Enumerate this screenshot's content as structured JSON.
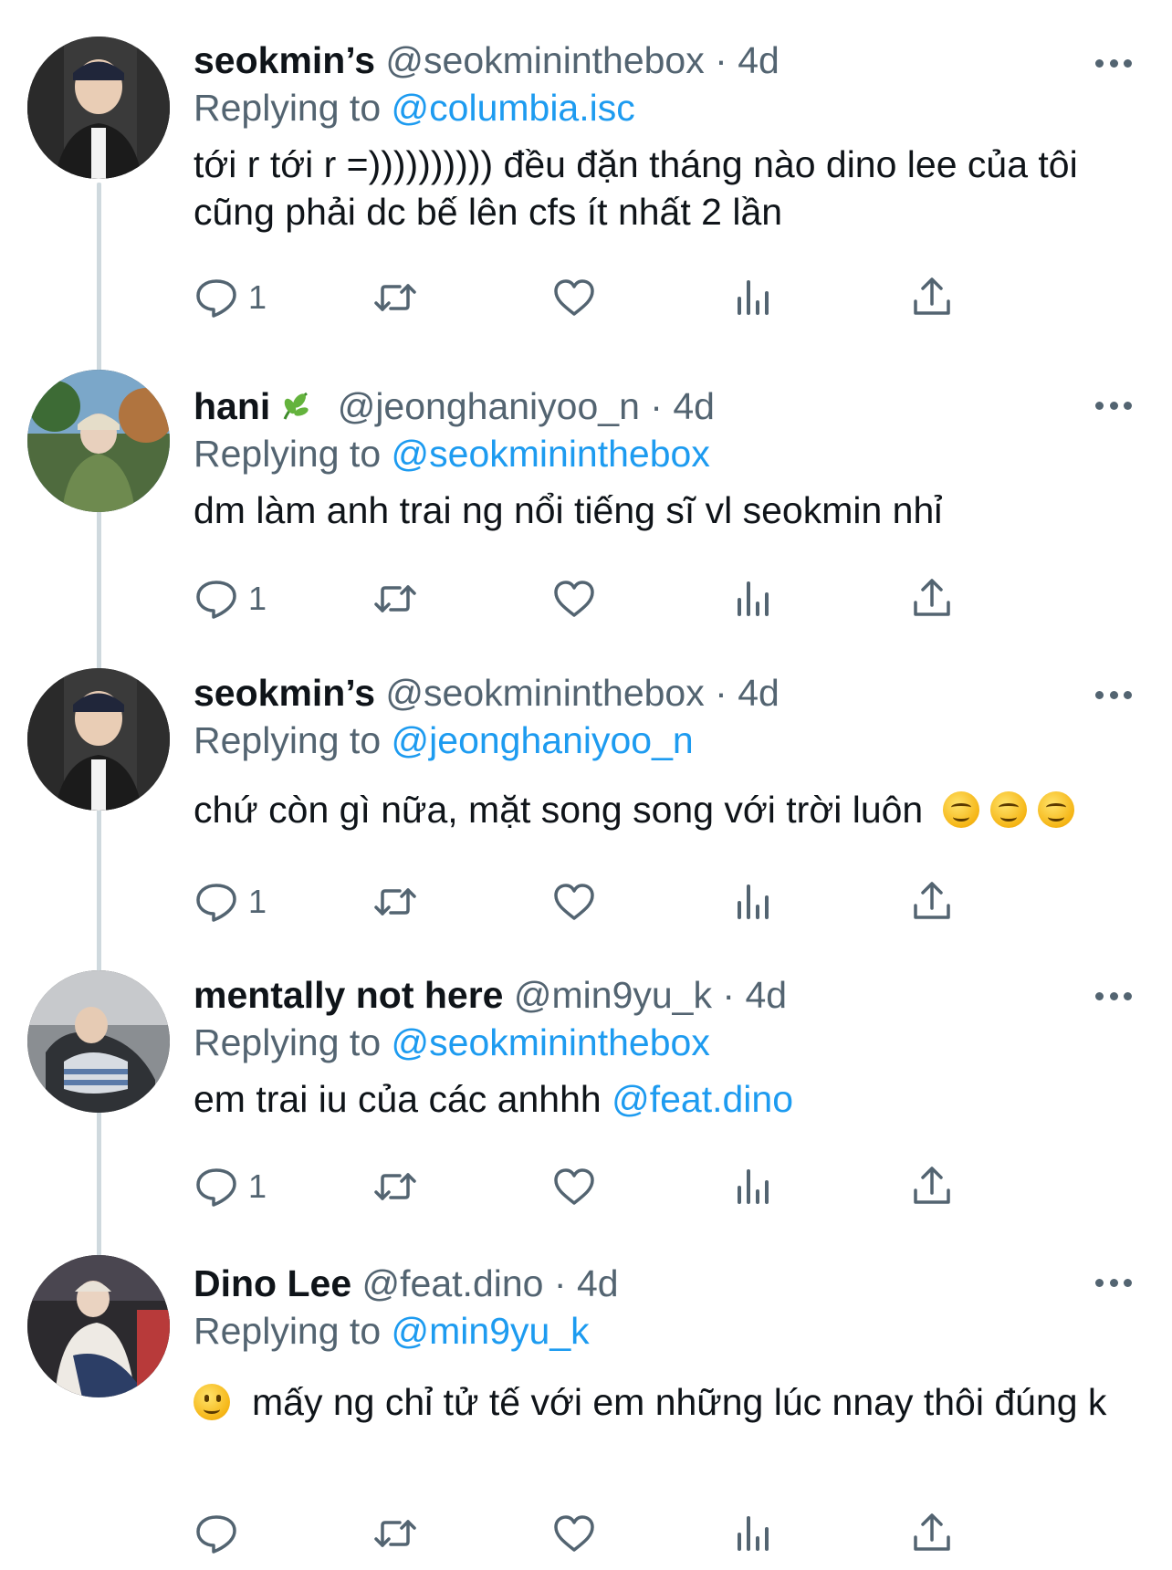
{
  "tweets": [
    {
      "name": "seokmin’s",
      "handle": "@seokmininthebox",
      "time": "4d",
      "replying_label": "Replying to",
      "replying_to": "@columbia.isc",
      "text": "tới r tới r =)))))))))) đều đặn tháng nào dino lee của tôi cũng phải dc bế lên cfs ít nhất 2 lần",
      "reply_count": "1"
    },
    {
      "name": "hani",
      "handle": "@jeonghaniyoo_n",
      "time": "4d",
      "replying_label": "Replying to",
      "replying_to": "@seokmininthebox",
      "text": "dm làm anh trai ng nổi tiếng sĩ vl seokmin nhỉ",
      "reply_count": "1"
    },
    {
      "name": "seokmin’s",
      "handle": "@seokmininthebox",
      "time": "4d",
      "replying_label": "Replying to",
      "replying_to": "@jeonghaniyoo_n",
      "text": "chứ còn gì nữa, mặt song song với trời luôn",
      "reply_count": "1"
    },
    {
      "name": "mentally not here",
      "handle": "@min9yu_k",
      "time": "4d",
      "replying_label": "Replying to",
      "replying_to": "@seokmininthebox",
      "text": "em trai iu của các anhhh",
      "text_mention": "@feat.dino",
      "reply_count": "1"
    },
    {
      "name": "Dino Lee",
      "handle": "@feat.dino",
      "time": "4d",
      "replying_label": "Replying to",
      "replying_to": "@min9yu_k",
      "text": "mấy ng chỉ tử tế với em những lúc nnay thôi đúng k",
      "reply_count": ""
    }
  ],
  "separator": "·",
  "icons": [
    "reply-icon",
    "retweet-icon",
    "like-icon",
    "analytics-icon",
    "share-icon",
    "more-icon",
    "leaf-emoji-icon",
    "smirk-emoji-icon",
    "slight-smile-emoji-icon"
  ],
  "colors": {
    "text": "#0f1419",
    "muted": "#536471",
    "link": "#1d9bf0",
    "thread": "#cfd9de"
  }
}
